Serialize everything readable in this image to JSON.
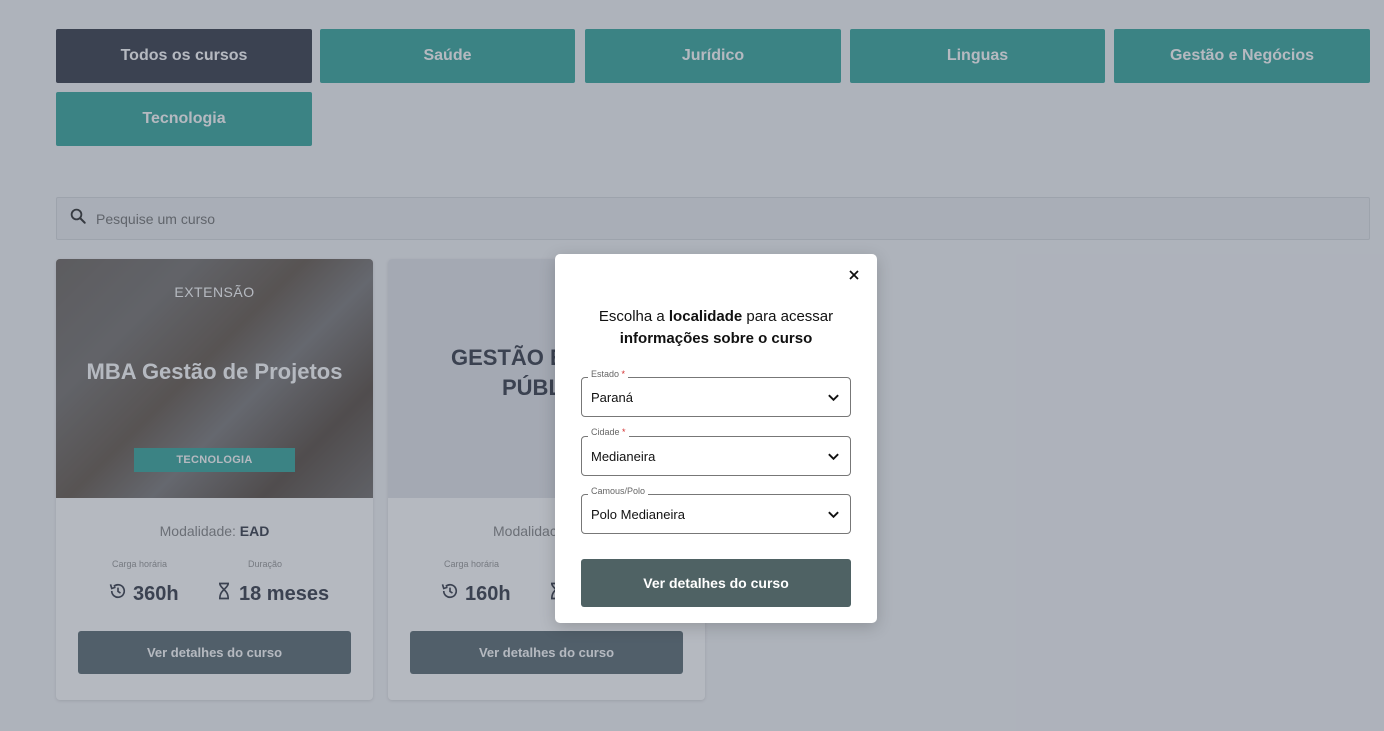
{
  "categories": [
    {
      "label": "Todos os cursos",
      "active": true
    },
    {
      "label": "Saúde",
      "active": false
    },
    {
      "label": "Jurídico",
      "active": false
    },
    {
      "label": "Linguas",
      "active": false
    },
    {
      "label": "Gestão e Negócios",
      "active": false
    },
    {
      "label": "Tecnologia",
      "active": false
    }
  ],
  "search": {
    "placeholder": "Pesquise um curso"
  },
  "cards": [
    {
      "tag": "EXTENSÃO",
      "title": "MBA Gestão de Projetos",
      "badge": "TECNOLOGIA",
      "modalidade_label": "Modalidade:",
      "modalidade_value": "EAD",
      "carga_label": "Carga horária",
      "carga_value": "360h",
      "duracao_label": "Duração",
      "duracao_value": "18 meses",
      "button": "Ver detalhes do curso"
    },
    {
      "title_line1": "GESTÃO EI",
      "title_line2": "PÚBL",
      "modalidade_label": "Modalidac",
      "carga_label": "Carga horária",
      "carga_value": "160h",
      "button": "Ver detalhes do curso"
    }
  ],
  "modal": {
    "heading_pre": "Escolha a ",
    "heading_bold1": "localidade",
    "heading_mid": " para acessar",
    "heading_bold2": "informações sobre o curso",
    "estado_label": "Estado",
    "estado_value": "Paraná",
    "cidade_label": "Cidade",
    "cidade_value": "Medianeira",
    "campus_label": "Camous/Polo",
    "campus_value": "Polo Medianeira",
    "required_mark": "*",
    "button": "Ver detalhes do curso"
  },
  "colors": {
    "teal": "#3aa89e",
    "dark": "#3b3f4c",
    "button_gray": "#5e6f74",
    "modal_button": "#4f6264"
  }
}
